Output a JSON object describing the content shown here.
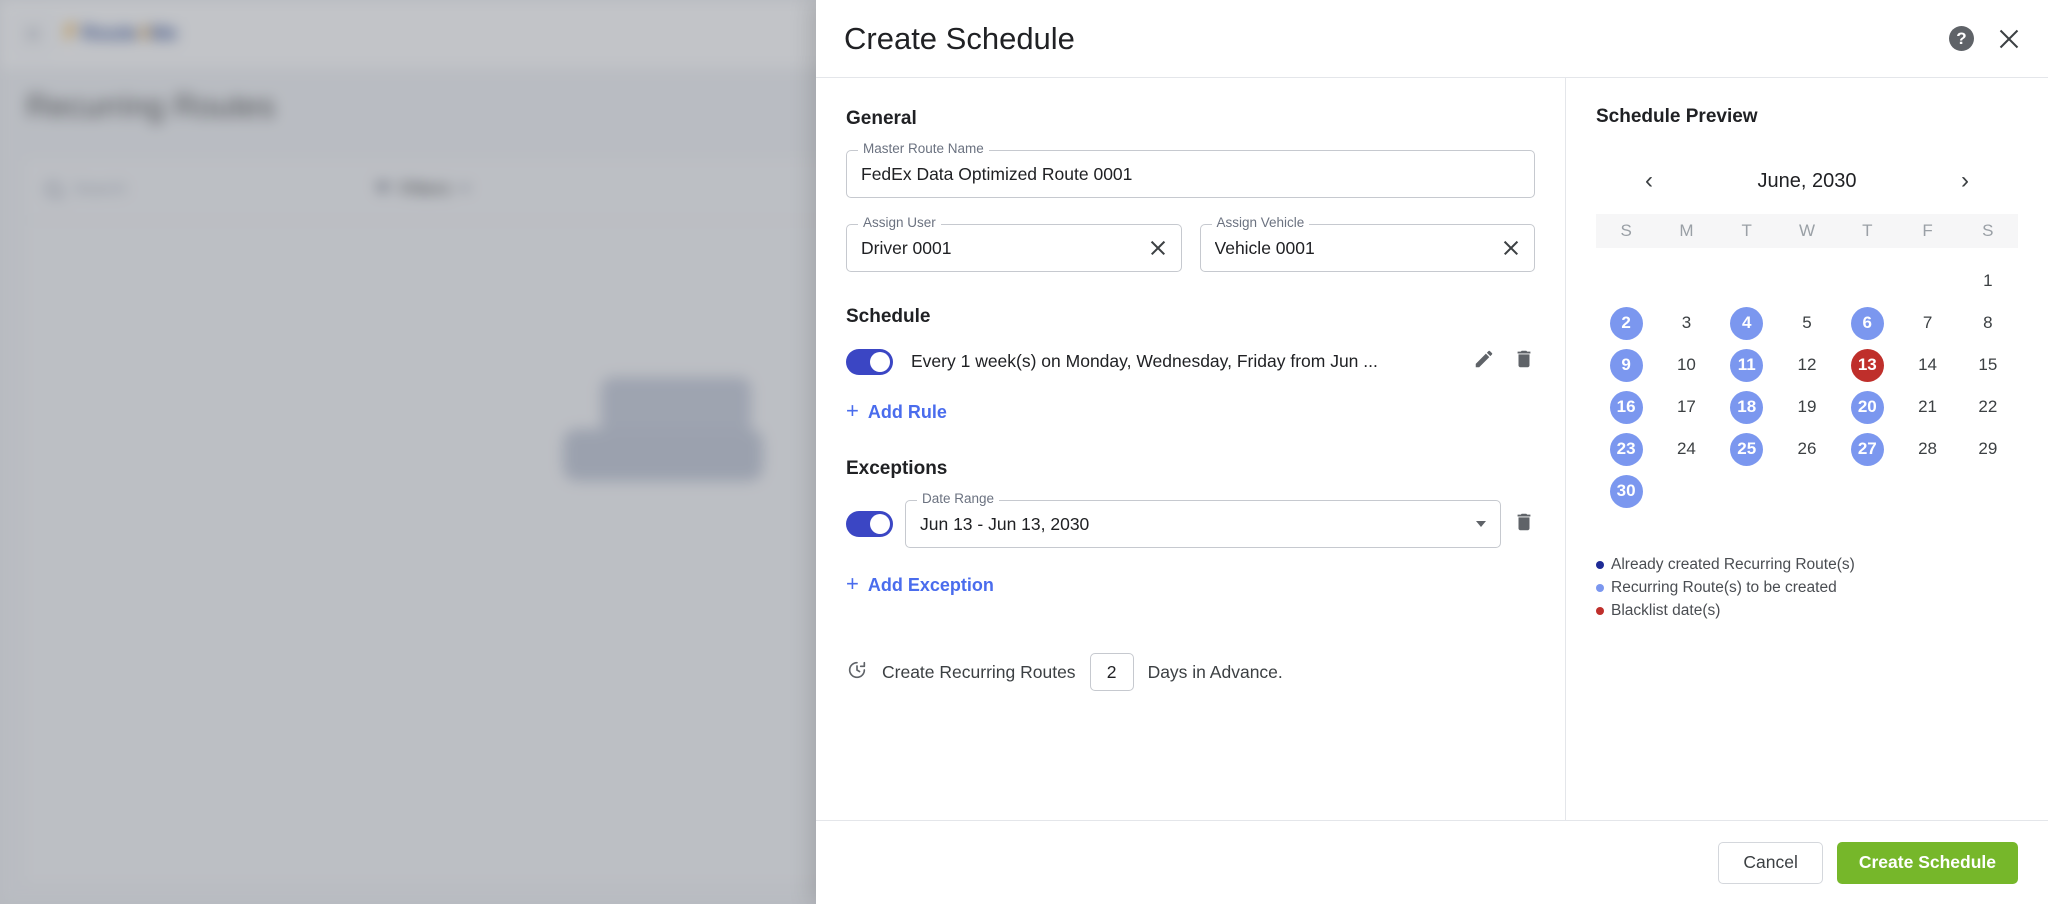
{
  "backdrop": {
    "logo_text": "Route",
    "logo_accent": "4",
    "logo_text2": "Me",
    "page_title": "Recurring Routes",
    "search_placeholder": "Search",
    "filters_label": "Filters"
  },
  "modal": {
    "title": "Create Schedule",
    "help_icon": "help-icon",
    "close_icon": "close-icon"
  },
  "general": {
    "section_title": "General",
    "master_route_name": {
      "label": "Master Route Name",
      "value": "FedEx Data Optimized Route 0001"
    },
    "assign_user": {
      "label": "Assign User",
      "value": "Driver 0001"
    },
    "assign_vehicle": {
      "label": "Assign Vehicle",
      "value": "Vehicle 0001"
    }
  },
  "schedule": {
    "section_title": "Schedule",
    "rule_text": "Every 1 week(s) on Monday, Wednesday, Friday from Jun ...",
    "rule_enabled": true,
    "edit_icon": "pencil-icon",
    "delete_icon": "trash-icon",
    "add_rule_label": "Add Rule",
    "add_rule_plus": "+"
  },
  "exceptions": {
    "section_title": "Exceptions",
    "date_range": {
      "label": "Date Range",
      "value": "Jun 13 - Jun 13, 2030"
    },
    "enabled": true,
    "delete_icon": "trash-icon",
    "add_exception_label": "Add Exception",
    "add_exception_plus": "+"
  },
  "advance": {
    "icon": "history-clock-icon",
    "prefix_label": "Create Recurring Routes",
    "days_value": "2",
    "suffix_label": "Days in Advance."
  },
  "preview": {
    "title": "Schedule Preview",
    "prev_icon": "chevron-left-icon",
    "next_icon": "chevron-right-icon",
    "month_label": "June, 2030",
    "dow": [
      "S",
      "M",
      "T",
      "W",
      "T",
      "F",
      "S"
    ],
    "lead_blanks": 6,
    "days": [
      {
        "n": "1",
        "state": "none"
      },
      {
        "n": "2",
        "state": "tocreate"
      },
      {
        "n": "3",
        "state": "none"
      },
      {
        "n": "4",
        "state": "tocreate"
      },
      {
        "n": "5",
        "state": "none"
      },
      {
        "n": "6",
        "state": "tocreate"
      },
      {
        "n": "7",
        "state": "none"
      },
      {
        "n": "8",
        "state": "none"
      },
      {
        "n": "9",
        "state": "tocreate"
      },
      {
        "n": "10",
        "state": "none"
      },
      {
        "n": "11",
        "state": "tocreate"
      },
      {
        "n": "12",
        "state": "none"
      },
      {
        "n": "13",
        "state": "blacklist"
      },
      {
        "n": "14",
        "state": "none"
      },
      {
        "n": "15",
        "state": "none"
      },
      {
        "n": "16",
        "state": "tocreate"
      },
      {
        "n": "17",
        "state": "none"
      },
      {
        "n": "18",
        "state": "tocreate"
      },
      {
        "n": "19",
        "state": "none"
      },
      {
        "n": "20",
        "state": "tocreate"
      },
      {
        "n": "21",
        "state": "none"
      },
      {
        "n": "22",
        "state": "none"
      },
      {
        "n": "23",
        "state": "tocreate"
      },
      {
        "n": "24",
        "state": "none"
      },
      {
        "n": "25",
        "state": "tocreate"
      },
      {
        "n": "26",
        "state": "none"
      },
      {
        "n": "27",
        "state": "tocreate"
      },
      {
        "n": "28",
        "state": "none"
      },
      {
        "n": "29",
        "state": "none"
      },
      {
        "n": "30",
        "state": "tocreate"
      }
    ],
    "legend": [
      {
        "label": "Already created Recurring Route(s)",
        "color": "#1f2b96"
      },
      {
        "label": "Recurring Route(s) to be created",
        "color": "#7b97ef"
      },
      {
        "label": "Blacklist date(s)",
        "color": "#bf2f2b"
      }
    ]
  },
  "footer": {
    "cancel_label": "Cancel",
    "submit_label": "Create Schedule",
    "submit_color": "#76b72a"
  }
}
